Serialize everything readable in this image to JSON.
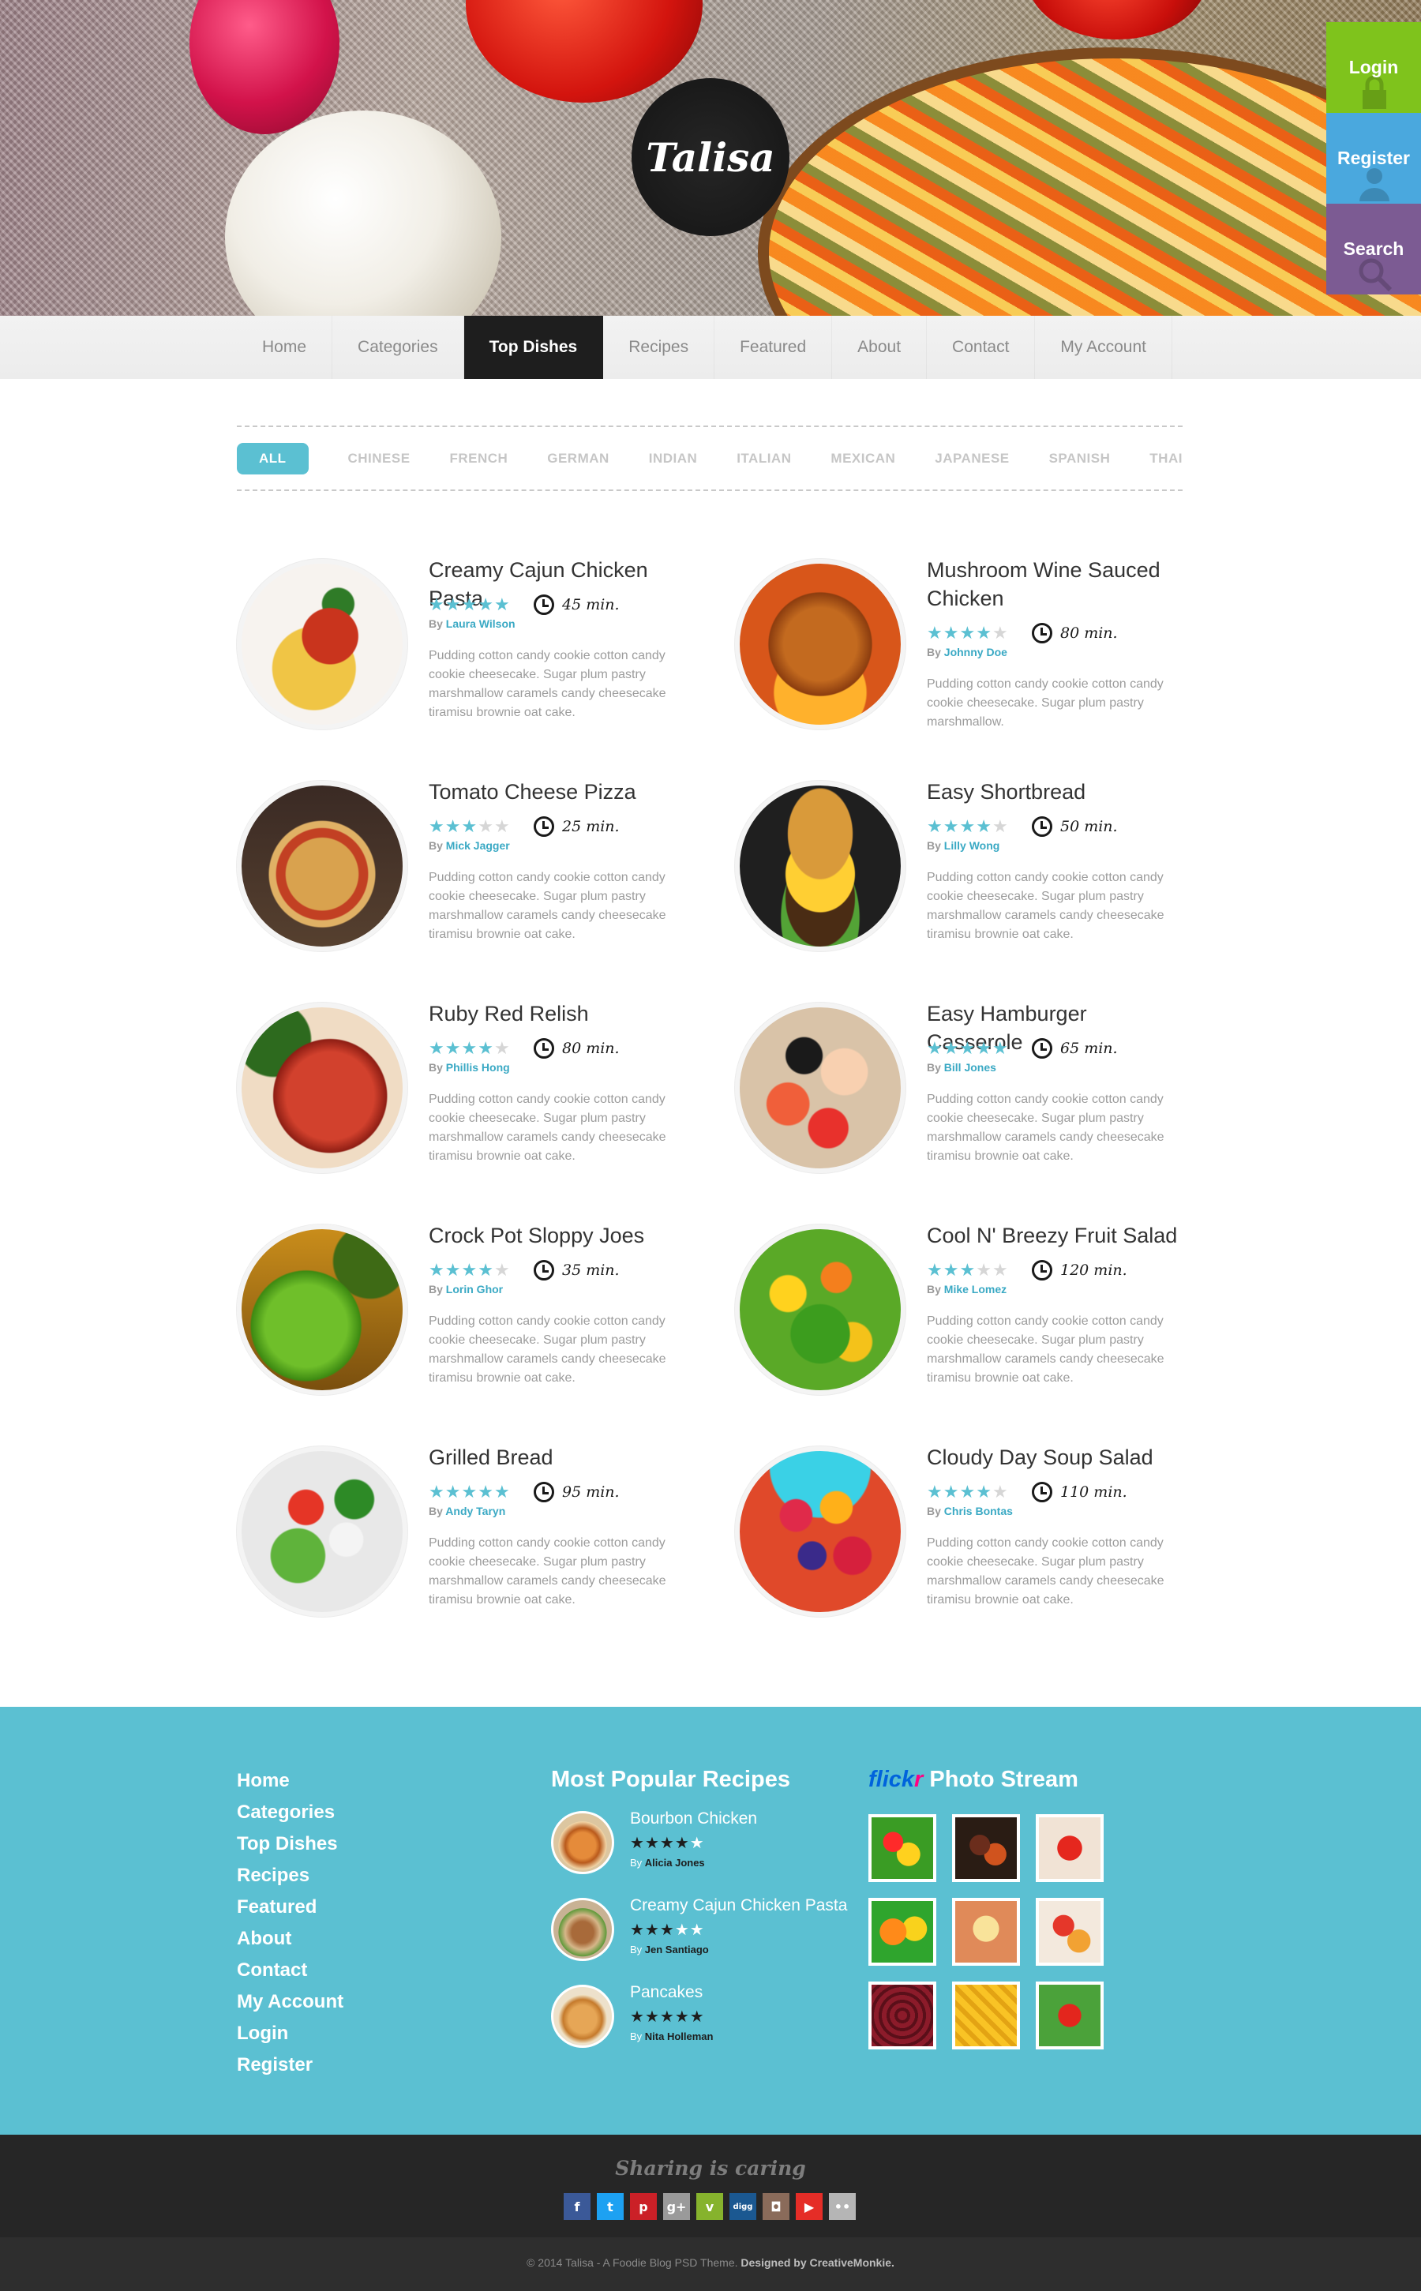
{
  "site": {
    "logo": "Talisa"
  },
  "side_tabs": [
    {
      "label": "Login",
      "color": "#7fc31c"
    },
    {
      "label": "Register",
      "color": "#4aa8de"
    },
    {
      "label": "Search",
      "color": "#7c5b93"
    }
  ],
  "nav": {
    "items": [
      "Home",
      "Categories",
      "Top Dishes",
      "Recipes",
      "Featured",
      "About",
      "Contact",
      "My Account"
    ],
    "active": "Top Dishes"
  },
  "filters": {
    "items": [
      "ALL",
      "CHINESE",
      "FRENCH",
      "GERMAN",
      "INDIAN",
      "ITALIAN",
      "MEXICAN",
      "JAPANESE",
      "SPANISH",
      "THAI"
    ],
    "active": "ALL"
  },
  "recipes": [
    {
      "title": "Creamy Cajun Chicken Pasta",
      "rating": 5,
      "by": "By",
      "author": "Laura Wilson",
      "time": "45 min.",
      "desc": "Pudding cotton candy cookie cotton candy cookie cheesecake. Sugar plum pastry marshmallow caramels candy cheesecake tiramisu brownie oat cake.",
      "image": "pasta"
    },
    {
      "title": "Mushroom Wine Sauced Chicken",
      "rating": 4,
      "by": "By",
      "author": "Johnny Doe",
      "time": "80 min.",
      "desc": "Pudding cotton candy cookie cotton candy cookie cheesecake. Sugar plum pastry marshmallow.",
      "image": "roast-chicken"
    },
    {
      "title": "Tomato Cheese Pizza",
      "rating": 3,
      "by": "By",
      "author": "Mick Jagger",
      "time": "25 min.",
      "desc": "Pudding cotton candy cookie cotton candy cookie cheesecake. Sugar plum pastry marshmallow caramels candy cheesecake tiramisu brownie oat cake.",
      "image": "pizza"
    },
    {
      "title": "Easy Shortbread",
      "rating": 4,
      "by": "By",
      "author": "Lilly Wong",
      "time": "50 min.",
      "desc": "Pudding cotton candy cookie cotton candy cookie cheesecake. Sugar plum pastry marshmallow caramels candy cheesecake tiramisu brownie oat cake.",
      "image": "burger"
    },
    {
      "title": "Ruby Red Relish",
      "rating": 4,
      "by": "By",
      "author": "Phillis Hong",
      "time": "80 min.",
      "desc": "Pudding cotton candy cookie cotton candy cookie cheesecake. Sugar plum pastry marshmallow caramels candy cheesecake tiramisu brownie oat cake.",
      "image": "beef"
    },
    {
      "title": "Easy Hamburger Casserole",
      "rating": 5,
      "by": "By",
      "author": "Bill Jones",
      "time": "65 min.",
      "desc": "Pudding cotton candy cookie cotton candy cookie cheesecake. Sugar plum pastry marshmallow caramels candy cheesecake tiramisu brownie oat cake.",
      "image": "sushi"
    },
    {
      "title": "Crock Pot Sloppy Joes",
      "rating": 4,
      "by": "By",
      "author": "Lorin Ghor",
      "time": "35 min.",
      "desc": "Pudding cotton candy cookie cotton candy cookie cheesecake. Sugar plum pastry marshmallow caramels candy cheesecake tiramisu brownie oat cake.",
      "image": "lime"
    },
    {
      "title": "Cool N' Breezy Fruit Salad",
      "rating": 3,
      "by": "By",
      "author": "Mike Lomez",
      "time": "120 min.",
      "desc": "Pudding cotton candy cookie cotton candy cookie cheesecake. Sugar plum pastry marshmallow caramels candy cheesecake tiramisu brownie oat cake.",
      "image": "salad"
    },
    {
      "title": "Grilled Bread",
      "rating": 5,
      "by": "By",
      "author": "Andy Taryn",
      "time": "95 min.",
      "desc": "Pudding cotton candy cookie cotton candy cookie cheesecake. Sugar plum pastry marshmallow caramels candy cheesecake tiramisu brownie oat cake.",
      "image": "greek-salad"
    },
    {
      "title": "Cloudy Day Soup Salad",
      "rating": 4,
      "by": "By",
      "author": "Chris Bontas",
      "time": "110 min.",
      "desc": "Pudding cotton candy cookie cotton candy cookie cheesecake. Sugar plum pastry marshmallow caramels candy cheesecake tiramisu brownie oat cake.",
      "image": "berries"
    }
  ],
  "footer": {
    "links": [
      "Home",
      "Categories",
      "Top Dishes",
      "Recipes",
      "Featured",
      "About",
      "Contact",
      "My Account",
      "Login",
      "Register"
    ],
    "popular_heading": "Most Popular Recipes",
    "popular": [
      {
        "title": "Bourbon Chicken",
        "rating": 4,
        "by": "By",
        "author": "Alicia Jones",
        "image": "sandwich"
      },
      {
        "title": "Creamy Cajun Chicken Pasta",
        "rating": 3,
        "by": "By",
        "author": "Jen Santiago",
        "image": "wrap"
      },
      {
        "title": "Pancakes",
        "rating": 5,
        "by": "By",
        "author": "Nita Holleman",
        "image": "pancakes"
      }
    ],
    "flickr_brand_a": "flick",
    "flickr_brand_b": "r",
    "flickr_heading": "Photo Stream",
    "flickr_photos": [
      "peppers",
      "berries-nuts",
      "tomato",
      "peppers-orange",
      "cheese",
      "tomatoes",
      "beans",
      "corn",
      "tomato-basil"
    ]
  },
  "share": {
    "title": "Sharing is caring",
    "networks": [
      {
        "name": "facebook-icon",
        "glyph": "f",
        "color": "#3b5998"
      },
      {
        "name": "twitter-icon",
        "glyph": "t",
        "color": "#1da1f2"
      },
      {
        "name": "pinterest-icon",
        "glyph": "p",
        "color": "#cb2027"
      },
      {
        "name": "google-plus-icon",
        "glyph": "g+",
        "color": "#9a9a9a"
      },
      {
        "name": "vimeo-icon",
        "glyph": "v",
        "color": "#86b32d"
      },
      {
        "name": "digg-icon",
        "glyph": "digg",
        "color": "#1b5891"
      },
      {
        "name": "instagram-icon",
        "glyph": "◘",
        "color": "#8a6b5a"
      },
      {
        "name": "youtube-icon",
        "glyph": "▶",
        "color": "#e52d27"
      },
      {
        "name": "flickr-icon",
        "glyph": "••",
        "color": "#b5b5b5"
      }
    ]
  },
  "copyright": {
    "text": "© 2014 Talisa - A Foodie Blog PSD Theme.",
    "designed": "Designed by CreativeMonkie."
  }
}
